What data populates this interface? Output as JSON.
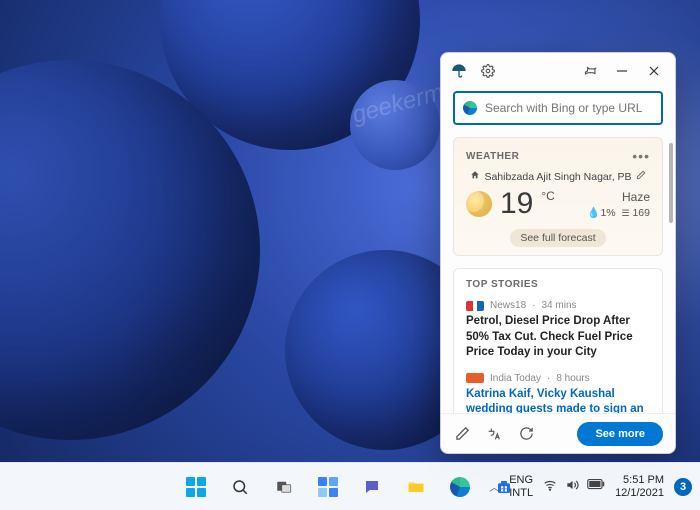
{
  "panel": {
    "search_placeholder": "Search with Bing or type URL",
    "weather": {
      "label": "WEATHER",
      "location": "Sahibzada Ajit Singh Nagar, PB",
      "temp": "19",
      "unit": "°C",
      "condition": "Haze",
      "precip": "1%",
      "aqi": "169",
      "forecast_btn": "See full forecast"
    },
    "news": {
      "label": "TOP STORIES",
      "stories": [
        {
          "source": "News18",
          "age": "34 mins",
          "headline": "Petrol, Diesel Price Drop After 50% Tax Cut. Check Fuel Price Price Today in your City"
        },
        {
          "source": "India Today",
          "age": "8 hours",
          "headline": "Katrina Kaif, Vicky Kaushal wedding guests made to sign an NDA clause. Exclusive..."
        }
      ]
    },
    "see_more": "See more"
  },
  "taskbar": {
    "lang1": "ENG",
    "lang2": "INTL",
    "time": "5:51 PM",
    "date": "12/1/2021",
    "notif_count": "3"
  }
}
